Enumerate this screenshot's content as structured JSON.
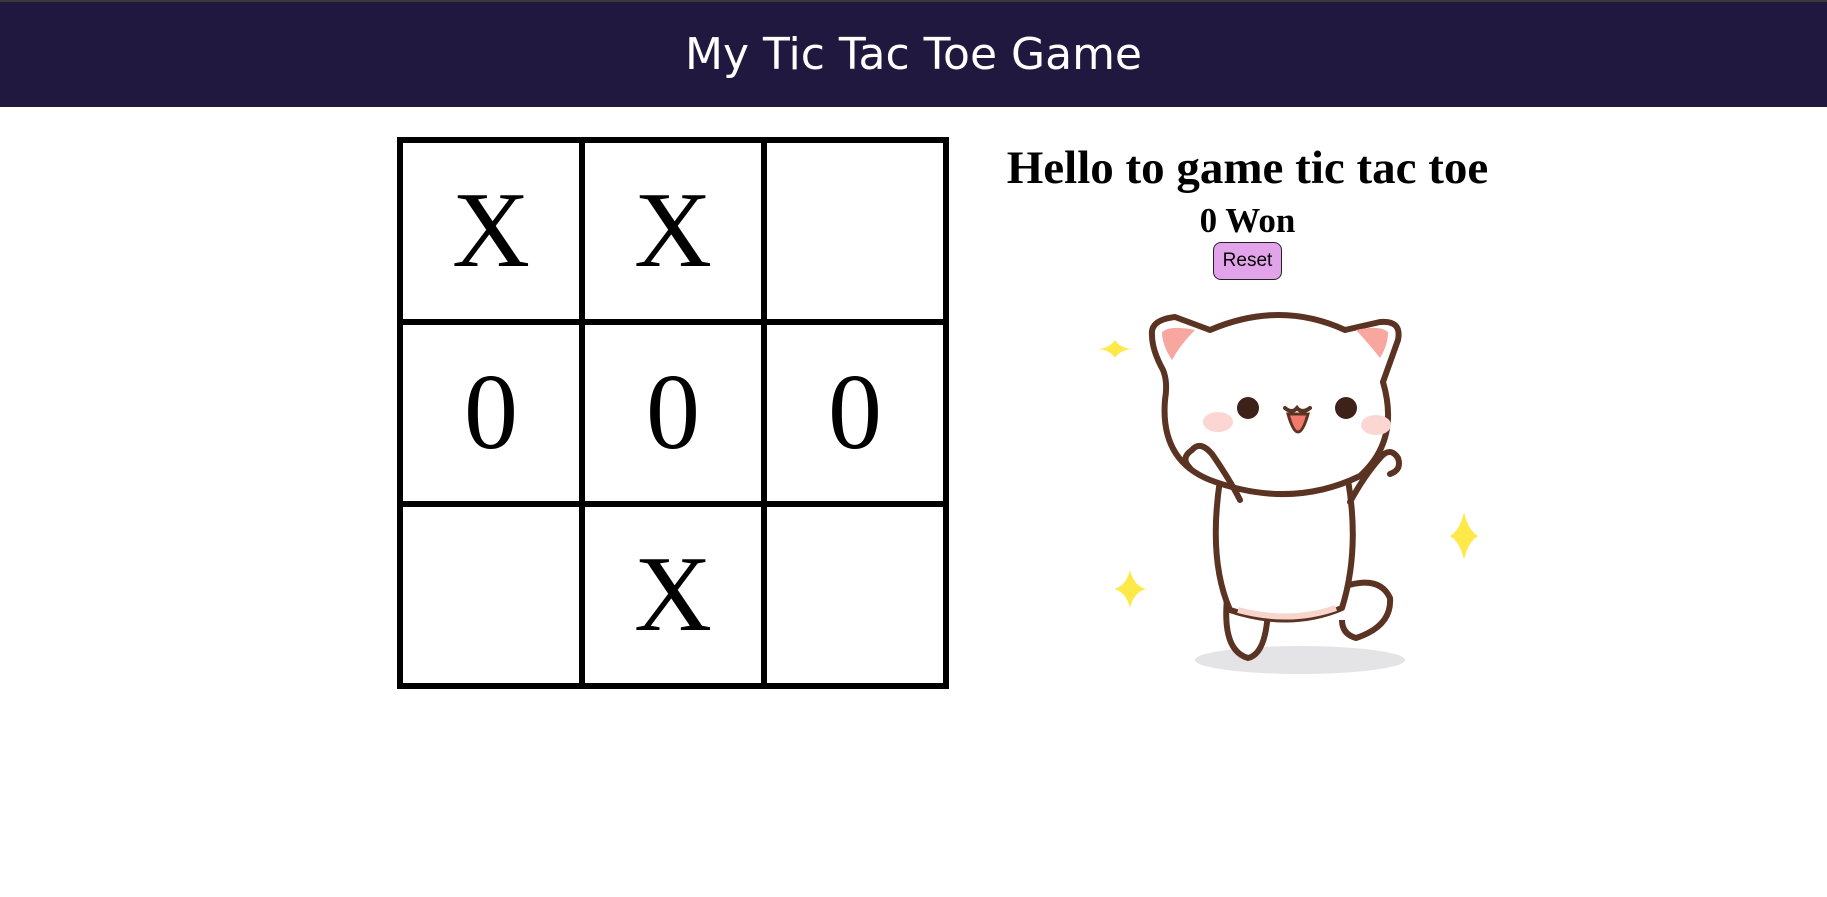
{
  "header": {
    "title": "My Tic Tac Toe Game",
    "background": "#21183f"
  },
  "board": {
    "cells": [
      "X",
      "X",
      "",
      "0",
      "0",
      "0",
      "",
      "X",
      ""
    ]
  },
  "side_panel": {
    "greeting": "Hello to game tic tac toe",
    "score_text": "0 Won",
    "reset_label": "Reset",
    "reset_color": "#e3a3ea"
  },
  "illustration": {
    "icon": "happy-cat-illustration",
    "sparkle_color": "#ffe94a"
  }
}
